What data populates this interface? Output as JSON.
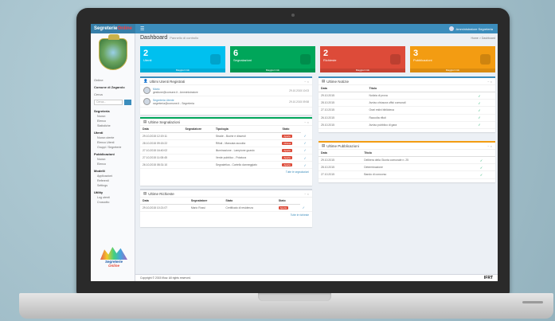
{
  "brand": {
    "part1": "Segreterie",
    "part2": "Online"
  },
  "topbar": {
    "user": "Amministratore Segreteria"
  },
  "sidebar": {
    "online": "Online",
    "org": "Comune di Zagarolo",
    "label": "Cerca",
    "search_placeholder": "Cerca...",
    "sections": [
      {
        "title": "Segreteria",
        "items": [
          "Nuovo",
          "Elenco",
          "Statistiche"
        ]
      },
      {
        "title": "Utenti",
        "items": [
          "Nuovo utente",
          "Elenco Utenti",
          "Gruppi / Segreterie"
        ]
      },
      {
        "title": "Pubblicazioni",
        "items": [
          "Nuovo",
          "Elenco"
        ]
      },
      {
        "title": "Modelli",
        "items": [
          "Applicazioni",
          "Referenti",
          "Settings"
        ]
      },
      {
        "title": "Utility",
        "items": [
          "Log utenti",
          "Cruscotto"
        ]
      }
    ],
    "logo_text": {
      "a": "Segreterie",
      "b": "Online"
    }
  },
  "page": {
    "title": "Dashboard",
    "subtitle": "Pannello di controllo",
    "breadcrumb": "Home  >  Dashboard"
  },
  "tiles": [
    {
      "num": "2",
      "label": "Utenti",
      "foot": "Maggiori info",
      "color": "#00c0ef"
    },
    {
      "num": "6",
      "label": "Segnalazioni",
      "foot": "Maggiori info",
      "color": "#00a65a"
    },
    {
      "num": "2",
      "label": "Richieste",
      "foot": "Maggiori info",
      "color": "#dd4b39"
    },
    {
      "num": "3",
      "label": "Pubblicazioni",
      "foot": "Maggiori info",
      "color": "#f39c12"
    }
  ],
  "users_box": {
    "title": "Ultimi Utenti Registrati",
    "rows": [
      {
        "name": "Mario",
        "sub": "gestione@comune.it - Amministratore",
        "date": "29.10.2015 10:03"
      },
      {
        "name": "Segreteria Utente",
        "sub": "segreteria@comune.it - Segreteria",
        "date": "29.10.2015 09:58"
      }
    ]
  },
  "reports_box": {
    "title": "Ultime Segnalazioni",
    "headers": [
      "Data",
      "Segnalatore",
      "Tipologia",
      "Stato"
    ],
    "rows": [
      {
        "date": "29.10.2015 12:19:11",
        "who": "",
        "type": "Strade - Buche e dissesti",
        "status": "Aperta"
      },
      {
        "date": "28.10.2015 09:15:22",
        "who": "",
        "type": "Rifiuti - Mancata raccolta",
        "status": "Chiusa"
      },
      {
        "date": "27.10.2015 16:40:02",
        "who": "",
        "type": "Illuminazione - Lampione guasto",
        "status": "Aperta"
      },
      {
        "date": "27.10.2015 11:08:45",
        "who": "",
        "type": "Verde pubblico - Potatura",
        "status": "Aperta"
      },
      {
        "date": "26.10.2015 08:31:10",
        "who": "",
        "type": "Segnaletica - Cartello danneggiato",
        "status": "Aperta"
      }
    ],
    "more": "Tutte le segnalazioni"
  },
  "requests_box": {
    "title": "Ultime Richieste",
    "headers": [
      "Data",
      "Segnalatore",
      "Stato",
      "Stato"
    ],
    "rows": [
      {
        "date": "29.10.2015 10:21:07",
        "who": "Mario Rossi",
        "type": "Certificato di residenza",
        "status": "Aperta"
      }
    ],
    "more": "Tutte le richieste"
  },
  "news_box": {
    "title": "Ultime Notizie",
    "headers": [
      "Data",
      "Titolo"
    ],
    "rows": [
      {
        "date": "29.10.2015",
        "title": "Notizia di prova"
      },
      {
        "date": "28.10.2015",
        "title": "Avviso chiusura uffici comunali"
      },
      {
        "date": "27.10.2015",
        "title": "Orari estivi biblioteca"
      },
      {
        "date": "26.10.2015",
        "title": "Raccolta rifiuti"
      },
      {
        "date": "25.10.2015",
        "title": "Avviso pubblico di gara"
      }
    ]
  },
  "events_box": {
    "title": "Ultime Pubblicazioni",
    "headers": [
      "Data",
      "Titolo"
    ],
    "rows": [
      {
        "date": "29.10.2015",
        "title": "Delibera della Giunta comunale n. 25"
      },
      {
        "date": "28.10.2015",
        "title": "Determinazione"
      },
      {
        "date": "27.10.2015",
        "title": "Bando di concorso"
      }
    ]
  },
  "footer": {
    "copy": "Copyright © 2015 Iflow. All rights reserved.",
    "brand": "IFRT"
  }
}
